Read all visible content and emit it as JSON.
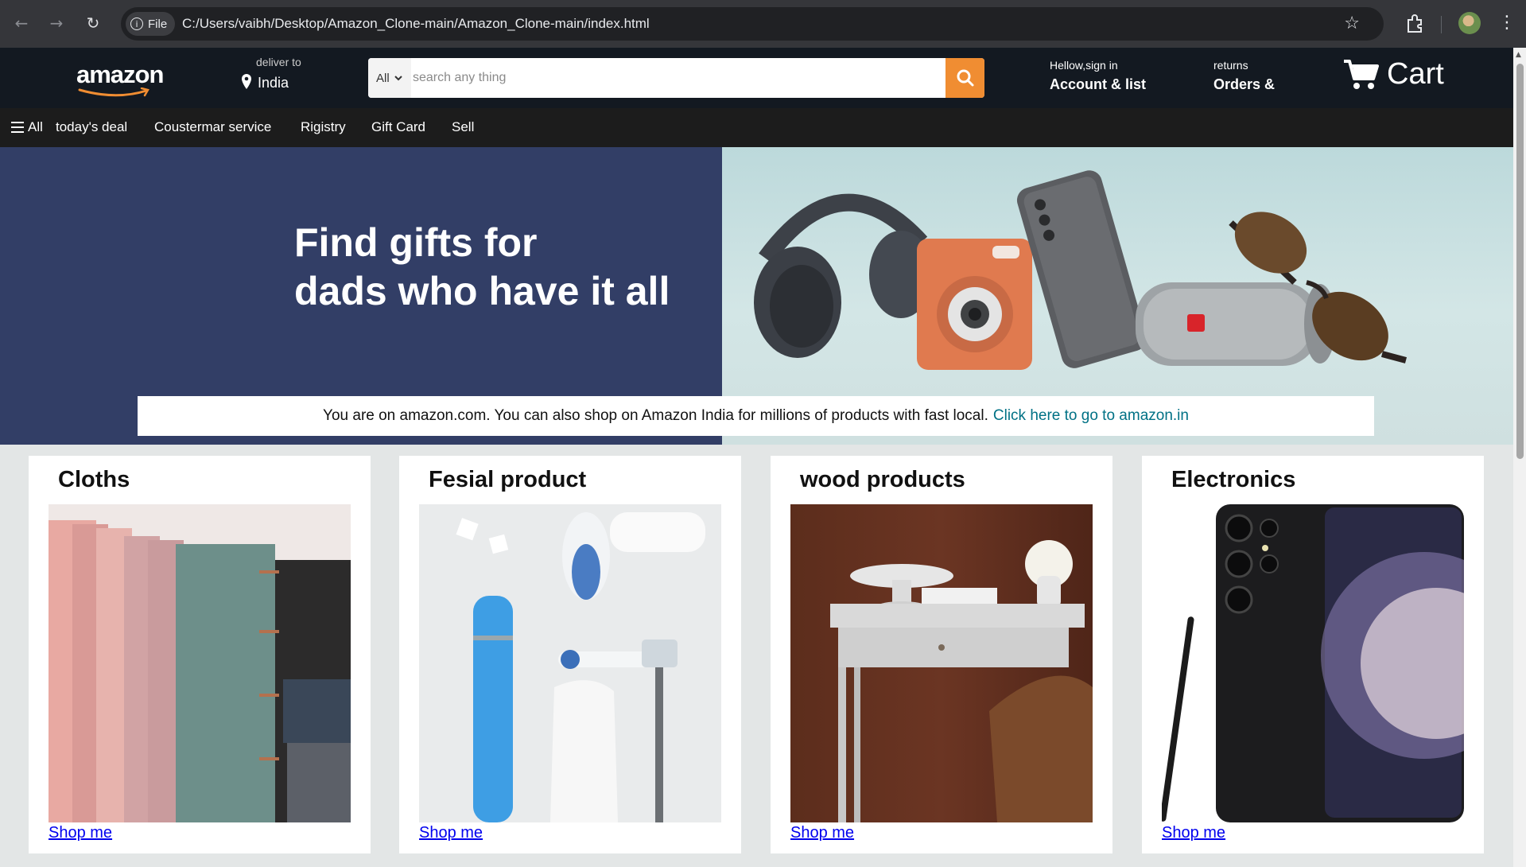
{
  "browser": {
    "back_icon": "arrow-left-icon",
    "forward_icon": "arrow-right-icon",
    "reload_icon": "reload-icon",
    "file_chip": "File",
    "url": "C:/Users/vaibh/Desktop/Amazon_Clone-main/Amazon_Clone-main/index.html"
  },
  "header": {
    "logo_text": "amazon",
    "deliver_label": "deliver to",
    "deliver_location": "India",
    "search": {
      "category": "All",
      "placeholder": "search any thing"
    },
    "account_greeting": "Hellow,sign in",
    "account_label": "Account & list",
    "returns_label": "returns",
    "orders_label": "Orders &",
    "cart_label": "Cart"
  },
  "subnav": {
    "all_label": "All",
    "items": [
      "today's deal",
      "Coustermar service",
      "Rigistry",
      "Gift Card",
      "Sell"
    ]
  },
  "hero": {
    "title_line1": "Find gifts for",
    "title_line2": "dads who have it all",
    "notice_text": "You are on amazon.com. You can also shop on Amazon India for millions of products with fast local.",
    "notice_link": "Click here to go to amazon.in"
  },
  "cards": [
    {
      "title": "Cloths",
      "link": "Shop me"
    },
    {
      "title": "Fesial product",
      "link": "Shop me"
    },
    {
      "title": "wood products",
      "link": "Shop me"
    },
    {
      "title": "Electronics",
      "link": "Shop me"
    }
  ],
  "colors": {
    "nav_bg": "#131921",
    "subnav_bg": "#1c1c1c",
    "search_button": "#f08d32",
    "hero_left": "#323e66",
    "link": "#007185"
  }
}
